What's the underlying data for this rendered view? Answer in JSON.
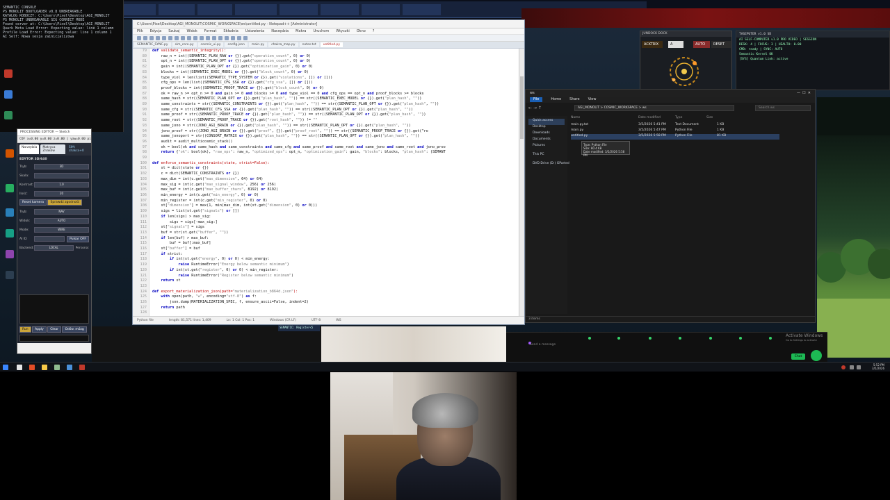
{
  "console": {
    "lines": [
      "SEMANTIC CONSOLE",
      "PS MONOLIT BOOTLOADER v0.8 UNBREAKABLE",
      "KATALOG ROBOCZY: C:\\Users\\Pixel\\Desktop\\AGI_MONOLIT",
      "PS MONOLIT UNBREAKABLE SIG CORRECT MODE",
      "Found server at: C:\\Users\\Pixel\\Desktop\\AGI_MONOLIT",
      "Quark Meta Load Error: Expecting value: line 1 column",
      "Profile Load Error: Expecting value: line 1 column 1",
      "AI Self: Nowa sesja zainicjalizowa"
    ]
  },
  "editor_panel": {
    "title": "PROCESSING EDYTOR — Sketch",
    "status": "COF x=0.00 y=0.00 z=0.00 | yaw=0.00 pitch=0.00",
    "tabs": [
      "Narzędzia",
      "Matryca Znaków",
      "SIM: chakra+0"
    ],
    "heading": "EDYTOR 3D/640",
    "rows": [
      {
        "label": "Tryb:",
        "value": "3D"
      },
      {
        "label": "Skala:",
        "value": ""
      },
      {
        "label": "Kontrast:",
        "value": "1.0"
      },
      {
        "label": "Ilość:",
        "value": "20"
      },
      {
        "label": "Tryb:",
        "value": "NAV"
      },
      {
        "label": "Widok:",
        "value": "AUTO"
      },
      {
        "label": "Mode:",
        "value": "WIRE"
      }
    ],
    "reset_label": "Reset kamera",
    "check_label": "Sprawdź zgodność",
    "ai_label": "AI ID",
    "pulsar_label": "Pulsar OFF",
    "backend_label": "Backend:",
    "backend_value": "LOCAL",
    "persona_label": "Persona:",
    "actions": [
      "Run",
      "Apply",
      "Clear",
      "Odśw. mózg"
    ]
  },
  "code_window": {
    "title": "C:\\Users\\Pixel\\Desktop\\AGI_MONOLIT\\COSMIC_WORKSPACE\\ws\\untitled.py - Notepad++ [Administrator]",
    "menu": [
      "Plik",
      "Edycja",
      "Szukaj",
      "Widok",
      "Format",
      "Składnia",
      "Ustawienia",
      "Narzędzia",
      "Makra",
      "Uruchom",
      "Wtyczki",
      "Okno",
      "?"
    ],
    "tabs": [
      "SEMANTIC_SYNC.py",
      "sim_core.py",
      "cosmic_ui.py",
      "config.json",
      "main.py",
      "chakra_map.py",
      "notes.txt",
      "untitled.py"
    ],
    "active_tab": "untitled.py",
    "gutter": [
      "79",
      "80",
      "81",
      "82",
      "83",
      "84",
      "85",
      "86",
      "87",
      "88",
      "89",
      "90",
      "91",
      "92",
      "93",
      "94",
      "95",
      "96",
      "97",
      "98",
      "99",
      "100",
      "101",
      "102",
      "103",
      "104",
      "105",
      "106",
      "107",
      "108",
      "109",
      "110",
      "111",
      "112",
      "113",
      "114",
      "115",
      "116",
      "117",
      "118",
      "119",
      "120",
      "121",
      "122",
      "123",
      "124",
      "125",
      "126",
      "127",
      "128"
    ],
    "lines": [
      "def validate_semantic_integrity():",
      "    raw_n = int((SEMANTIC_PLAN_RAW or {}).get(\"operation_count\", 0) or 0)",
      "    opt_n = int((SEMANTIC_PLAN_OPT or {}).get(\"operation_count\", 0) or 0)",
      "    gain = int((SEMANTIC_PLAN_OPT or {}).get(\"optimization_gain\", 0) or 0)",
      "    blocks = int((SEMANTIC_EXEC_MODEL or {}).get(\"block_count\", 0) or 0)",
      "    type_viol = len(list((SEMANTIC_TYPE_SYSTEM or {}).get(\"violations\", []) or []))",
      "    cfg_ops = len(list((SEMANTIC_CFG_SSA or {}).get(\"cfg_ssa\", []) or []))",
      "    proof_blocks = int((SEMANTIC_PROOF_TRACE or {}).get(\"block_count\", 0) or 0)",
      "    ok = raw_n >= opt_n >= 0 and gain >= 0 and blocks >= 0 and type_viol == 0 and cfg_ops == opt_n and proof_blocks >= blocks",
      "    same_hash = str((SEMANTIC_PLAN_OPT or {}).get(\"plan_hash\", \"\")) == str((SEMANTIC_EXEC_MODEL or {}).get(\"plan_hash\", \"\"))",
      "    same_constraints = str((SEMANTIC_CONSTRAINTS or {}).get(\"plan_hash\", \"\")) == str((SEMANTIC_PLAN_OPT or {}).get(\"plan_hash\", \"\"))",
      "    same_cfg = str((SEMANTIC_CFG_SSA or {}).get(\"plan_hash\", \"\")) == str((SEMANTIC_PLAN_OPT or {}).get(\"plan_hash\", \"\"))",
      "    same_proof = str((SEMANTIC_PROOF_TRACE or {}).get(\"plan_hash\", \"\")) == str((SEMANTIC_PLAN_OPT or {}).get(\"plan_hash\", \"\"))",
      "    same_root = str((SEMANTIC_PROOF_TRACE or {}).get(\"root_hash\", \"\")) != \"\"",
      "    same_jono = str((JONO_AGI_BRAIN or {}).get(\"plan_hash\", \"\")) == str((SEMANTIC_PLAN_OPT or {}).get(\"plan_hash\", \"\"))",
      "    jono_proof = str((JONO_AGI_BRAIN or {}).get(\"proof\", {}).get(\"proof_root\", \"\")) == str((SEMANTIC_PROOF_TRACE or {}).get(\"ro",
      "    same_jonoport = str((CONSORT_MATRIX or {}).get(\"plan_hash\", \"\")) == str((SEMANTIC_PLAN_OPT or {}).get(\"plan_hash\", \"\"))",
      "    audit = audit_multicosmic_stack()",
      "    ok = bool(ok and same_hash and same_constraints and same_cfg and same_proof and same_root and same_jono and same_root and jono_proo",
      "    return {\"ok\": bool(ok), \"raw_ops\": raw_n, \"optimized_ops\": opt_n, \"optimization_gain\": gain, \"blocks\": blocks, \"plan_hash\": (SEMANT",
      "",
      "def enforce_semantic_constraints(state, strict=False):",
      "    st = dict(state or {})",
      "    c = dict(SEMANTIC_CONSTRAINTS or {})",
      "    max_dim = int(c.get(\"max_dimension\", 64) or 64)",
      "    max_sig = int(c.get(\"max_signal_window\", 256) or 256)",
      "    max_buf = int(c.get(\"max_buffer_chars\", 8192) or 8192)",
      "    min_energy = int(c.get(\"min_energy\", 0) or 0)",
      "    min_register = int(c.get(\"min_register\", 0) or 0)",
      "    st[\"dimension\"] = max(1, min(max_dim, int(st.get(\"dimension\", 0) or 0)))",
      "    sigs = list(st.get(\"signals\") or [])",
      "    if len(sigs) > max_sig:",
      "        sigs = sigs[-max_sig:]",
      "    st[\"signals\"] = sigs",
      "    buf = str(st.get(\"buffer\", \"\"))",
      "    if len(buf) > max_buf:",
      "        buf = buf[:max_buf]",
      "    st[\"buffer\"] = buf",
      "    if strict:",
      "        if int(st.get(\"energy\", 0) or 0) < min_energy:",
      "            raise RuntimeError(\"Energy below semantic minimum\")",
      "        if int(st.get(\"register\", 0) or 0) < min_register:",
      "            raise RuntimeError(\"Register below semantic minimum\")",
      "    return st",
      "",
      "def export_materialization_json(path=\"materialization_b864d.json\"):",
      "    with open(path, \"w\", encoding=\"utf-8\") as f:",
      "        json.dump(MATERIALIZATION_SPEC, f, ensure_ascii=False, indent=2)",
      "    return path"
    ],
    "status": [
      "Python file",
      "length: 81,571   lines: 1,409",
      "Ln: 1   Col: 1   Pos: 1",
      "Windows (CR LF)",
      "UTF-8",
      "INS"
    ]
  },
  "mid_caption": "SEMANTIC: Register<5",
  "dock": {
    "title": "JUNDOCK  DOCK",
    "buttons": [
      "ACKTRIX",
      "A",
      "AUTO",
      "RESET"
    ]
  },
  "tasep": {
    "title": "TASEPUTER v1.0   SD",
    "lines": [
      "AI SELF-COMPUTER v1.0   PRO VIDEO | SESSION",
      "DESK: 4 | FOCUS: 3 | HEALTH: 0.00",
      "CMD: ready | SYNC: AUTO",
      "Semantic Kernel OK",
      "[SYS] Quantum Link: active"
    ]
  },
  "explorer": {
    "title": "ws",
    "ribbon": [
      "File",
      "Home",
      "Share",
      "View"
    ],
    "path": "AGI_MONOLIT  >  COSMIC_WORKSPACE  >  ws",
    "search": "Search ws",
    "nav": [
      "Quick access",
      "Desktop",
      "Downloads",
      "Documents",
      "Pictures",
      "This PC",
      "DVD Drive (D:) GParted"
    ],
    "headers": [
      "Name",
      "Date modified",
      "Type",
      "Size"
    ],
    "files": [
      {
        "name": "main.py.txt",
        "date": "3/5/2026 5:41 PM",
        "type": "Text Document",
        "size": "1 KB"
      },
      {
        "name": "main.py",
        "date": "3/5/2026 5:47 PM",
        "type": "Python File",
        "size": "1 KB"
      },
      {
        "name": "untitled.py",
        "date": "3/5/2026 5:58 PM",
        "type": "Python File",
        "size": "81 KB"
      }
    ],
    "tooltip": [
      "Type: Python File",
      "Size: 80.4 KB",
      "Date modified: 3/5/2026 5:58 PM"
    ],
    "status": "3 items"
  },
  "chat": {
    "placeholder": "Send a message",
    "send": "Chat"
  },
  "activate": {
    "title": "Activate Windows",
    "sub": "Go to Settings to activate"
  },
  "clock": {
    "time": "5:52 PM",
    "date": "3/5/2026"
  },
  "colors": {
    "accent": "#1a5fb4",
    "chat_green": "#1db954"
  }
}
